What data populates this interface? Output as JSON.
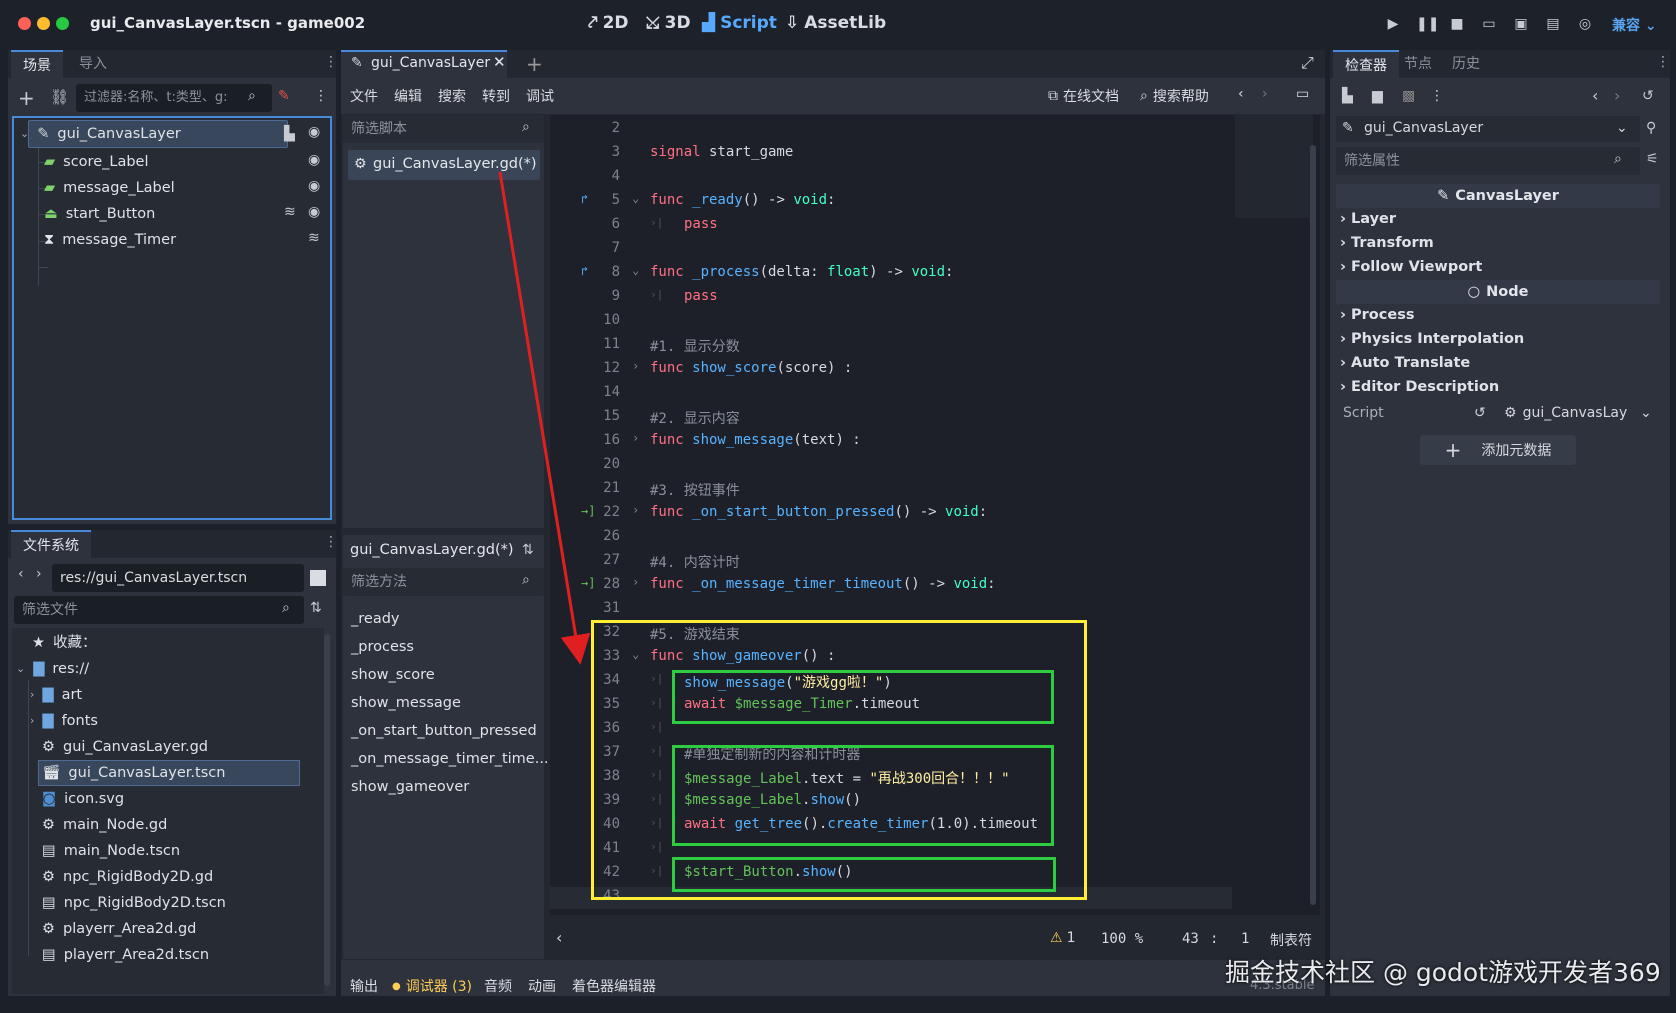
{
  "window": {
    "title": "gui_CanvasLayer.tscn - game002"
  },
  "main_buttons": {
    "b2d": "2D",
    "b3d": "3D",
    "script": "Script",
    "assetlib": "AssetLib"
  },
  "renderer": "兼容",
  "scene_dock": {
    "tabs": [
      "场景",
      "导入"
    ],
    "filter_placeholder": "过滤器:名称、t:类型、g:",
    "nodes": [
      "gui_CanvasLayer",
      "score_Label",
      "message_Label",
      "start_Button",
      "message_Timer"
    ]
  },
  "fs_dock": {
    "tab": "文件系统",
    "path": "res://gui_CanvasLayer.tscn",
    "filter_placeholder": "筛选文件",
    "favorites": "收藏：",
    "root": "res://",
    "items": [
      "art",
      "fonts",
      "gui_CanvasLayer.gd",
      "gui_CanvasLayer.tscn",
      "icon.svg",
      "main_Node.gd",
      "main_Node.tscn",
      "npc_RigidBody2D.gd",
      "npc_RigidBody2D.tscn",
      "playerr_Area2d.gd",
      "playerr_Area2d.tscn"
    ]
  },
  "script_editor": {
    "tab_label": "gui_CanvasLayer",
    "menus": [
      "文件",
      "编辑",
      "搜索",
      "转到",
      "调试"
    ],
    "online_docs": "在线文档",
    "search_help": "搜索帮助",
    "filter_scripts": "筛选脚本",
    "script_item": "gui_CanvasLayer.gd(*)",
    "methods_header": "gui_CanvasLayer.gd(*)",
    "filter_methods": "筛选方法",
    "methods": [
      "_ready",
      "_process",
      "show_score",
      "show_message",
      "_on_start_button_pressed",
      "_on_message_timer_time...",
      "show_gameover"
    ]
  },
  "code": {
    "line_numbers": [
      "2",
      "3",
      "4",
      "5",
      "6",
      "7",
      "8",
      "9",
      "10",
      "11",
      "12",
      "14",
      "15",
      "16",
      "20",
      "21",
      "22",
      "26",
      "27",
      "28",
      "31",
      "32",
      "33",
      "34",
      "35",
      "36",
      "37",
      "38",
      "39",
      "40",
      "41",
      "42",
      "43"
    ],
    "l3": [
      "signal",
      " start_game"
    ],
    "l5": [
      "func",
      " _ready",
      "() -> ",
      "void",
      ":"
    ],
    "l6": "pass",
    "l8": [
      "func",
      " _process",
      "(delta: ",
      "float",
      ") -> ",
      "void",
      ":"
    ],
    "l9": "pass",
    "l11": "#1. 显示分数",
    "l12": [
      "func",
      " show_score",
      "(score) :"
    ],
    "l15": "#2. 显示内容",
    "l16": [
      "func",
      " show_message",
      "(text) :"
    ],
    "l21": "#3. 按钮事件",
    "l22": [
      "func",
      " _on_start_button_pressed",
      "() -> ",
      "void",
      ":"
    ],
    "l27": "#4. 内容计时",
    "l28": [
      "func",
      " _on_message_timer_timeout",
      "() -> ",
      "void",
      ":"
    ],
    "l32": "#5. 游戏结束",
    "l33": [
      "func",
      " show_gameover",
      "() :"
    ],
    "l34": [
      "show_message",
      "(",
      "\"游戏gg啦！\"",
      ")"
    ],
    "l35": [
      "await",
      " $message_Timer",
      ".timeout"
    ],
    "l37": "#单独定制新的内容和计时器",
    "l38": [
      "$message_Label",
      ".text = ",
      "\"再战300回合！！！\""
    ],
    "l39": [
      "$message_Label",
      ".",
      "show",
      "()"
    ],
    "l40": [
      "await",
      " get_tree",
      "().",
      "create_timer",
      "(1.0).timeout"
    ],
    "l42": [
      "$start_Button",
      ".",
      "show",
      "()"
    ]
  },
  "status": {
    "warnings": "1",
    "zoom": "100 %",
    "line": "43",
    "col": "1",
    "indent": "制表符"
  },
  "bottom_tabs": [
    "输出",
    "调试器 (3)",
    "音频",
    "动画",
    "着色器编辑器"
  ],
  "version": "4.3.stable",
  "watermark": "掘金技术社区 @ godot游戏开发者369",
  "inspector": {
    "tabs": [
      "检查器",
      "节点",
      "历史"
    ],
    "object": "gui_CanvasLayer",
    "filter_placeholder": "筛选属性",
    "class_header": "CanvasLayer",
    "groups1": [
      "Layer",
      "Transform",
      "Follow Viewport"
    ],
    "node_header": "Node",
    "groups2": [
      "Process",
      "Physics Interpolation",
      "Auto Translate",
      "Editor Description"
    ],
    "script_label": "Script",
    "script_value": "gui_CanvasLay",
    "add_metadata": "添加元数据"
  },
  "colors": {
    "accent": "#468ad9",
    "highlight_yellow": "#ffee33",
    "highlight_green": "#2ecc40",
    "arrow_red": "#e02020"
  }
}
